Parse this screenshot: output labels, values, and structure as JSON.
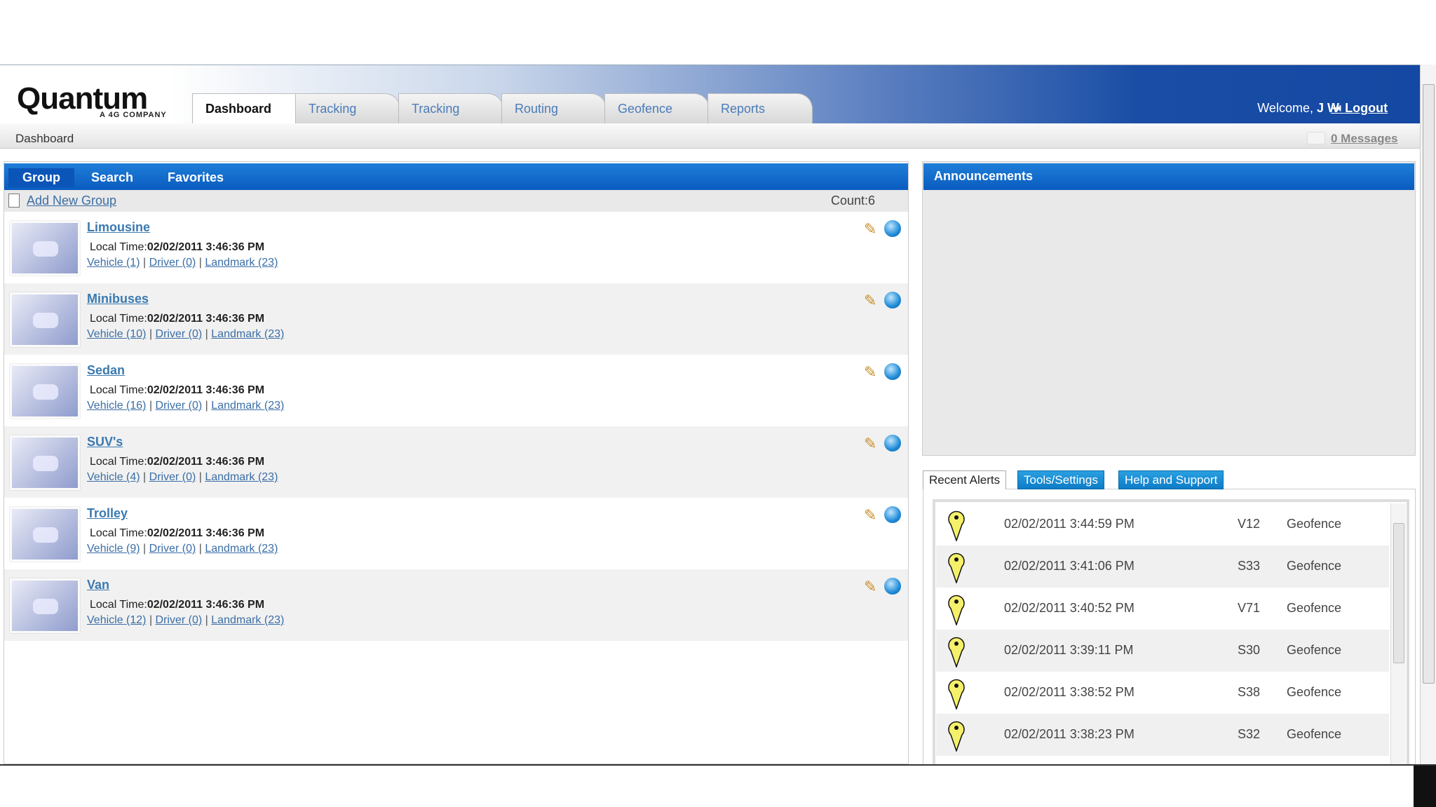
{
  "header": {
    "logo_text": "Quantum",
    "logo_sub": "A 4G COMPANY",
    "welcome": "Welcome,",
    "user": "J W",
    "logout": "Logout",
    "tabs": [
      "Dashboard",
      "Tracking",
      "Tracking",
      "Routing",
      "Geofence",
      "Reports"
    ]
  },
  "breadcrumb": "Dashboard",
  "messages": "0 Messages",
  "left": {
    "tabs": [
      "Group",
      "Search",
      "Favorites"
    ],
    "add_new": "Add New Group",
    "count": "Count:6",
    "local_time_label": "Local Time:",
    "groups": [
      {
        "name": "Limousine",
        "time": "02/02/2011 3:46:36 PM",
        "vehicle": "Vehicle (1)",
        "driver": "Driver (0)",
        "landmark": "Landmark (23)"
      },
      {
        "name": "Minibuses",
        "time": "02/02/2011 3:46:36 PM",
        "vehicle": "Vehicle (10)",
        "driver": "Driver (0)",
        "landmark": "Landmark (23)"
      },
      {
        "name": "Sedan",
        "time": "02/02/2011 3:46:36 PM",
        "vehicle": "Vehicle (16)",
        "driver": "Driver (0)",
        "landmark": "Landmark (23)"
      },
      {
        "name": "SUV's",
        "time": "02/02/2011 3:46:36 PM",
        "vehicle": "Vehicle (4)",
        "driver": "Driver (0)",
        "landmark": "Landmark (23)"
      },
      {
        "name": "Trolley",
        "time": "02/02/2011 3:46:36 PM",
        "vehicle": "Vehicle (9)",
        "driver": "Driver (0)",
        "landmark": "Landmark (23)"
      },
      {
        "name": "Van",
        "time": "02/02/2011 3:46:36 PM",
        "vehicle": "Vehicle (12)",
        "driver": "Driver (0)",
        "landmark": "Landmark (23)"
      }
    ]
  },
  "announcements": {
    "title": "Announcements"
  },
  "alerts": {
    "tabs": [
      "Recent Alerts",
      "Tools/Settings",
      "Help and Support"
    ],
    "rows": [
      {
        "datetime": "02/02/2011 3:44:59 PM",
        "id": "V12",
        "type": "Geofence"
      },
      {
        "datetime": "02/02/2011 3:41:06 PM",
        "id": "S33",
        "type": "Geofence"
      },
      {
        "datetime": "02/02/2011 3:40:52 PM",
        "id": "V71",
        "type": "Geofence"
      },
      {
        "datetime": "02/02/2011 3:39:11 PM",
        "id": "S30",
        "type": "Geofence"
      },
      {
        "datetime": "02/02/2011 3:38:52 PM",
        "id": "S38",
        "type": "Geofence"
      },
      {
        "datetime": "02/02/2011 3:38:23 PM",
        "id": "S32",
        "type": "Geofence"
      }
    ]
  }
}
